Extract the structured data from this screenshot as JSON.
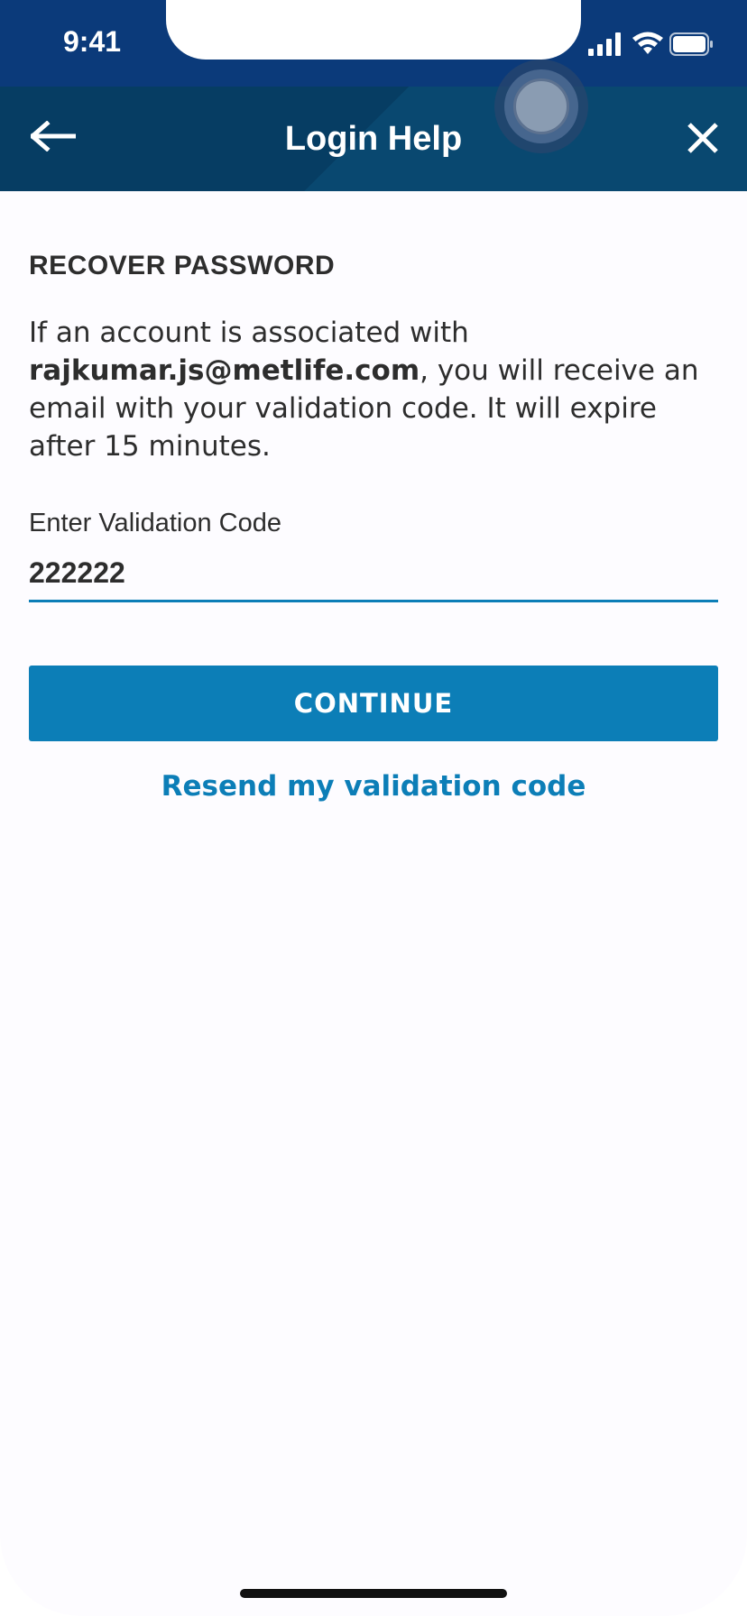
{
  "status_bar": {
    "time": "9:41",
    "icons": [
      "signal-icon",
      "wifi-icon",
      "battery-icon"
    ]
  },
  "header": {
    "title": "Login Help",
    "back_icon": "arrow-left-icon",
    "close_icon": "close-icon"
  },
  "content": {
    "section_title": "RECOVER PASSWORD",
    "info_prefix": "If an account is associated with ",
    "email": "rajkumar.js@metlife.com",
    "info_suffix": ", you will receive an email with your validation code. It will expire after 15 minutes.",
    "field_label": "Enter Validation Code",
    "code_value": "222222",
    "continue_label": "CONTINUE",
    "resend_label": "Resend my validation code"
  },
  "colors": {
    "status_bar": "#0b3a7a",
    "header": "#063d63",
    "accent": "#0c7eb7",
    "text": "#2d2d2d"
  }
}
